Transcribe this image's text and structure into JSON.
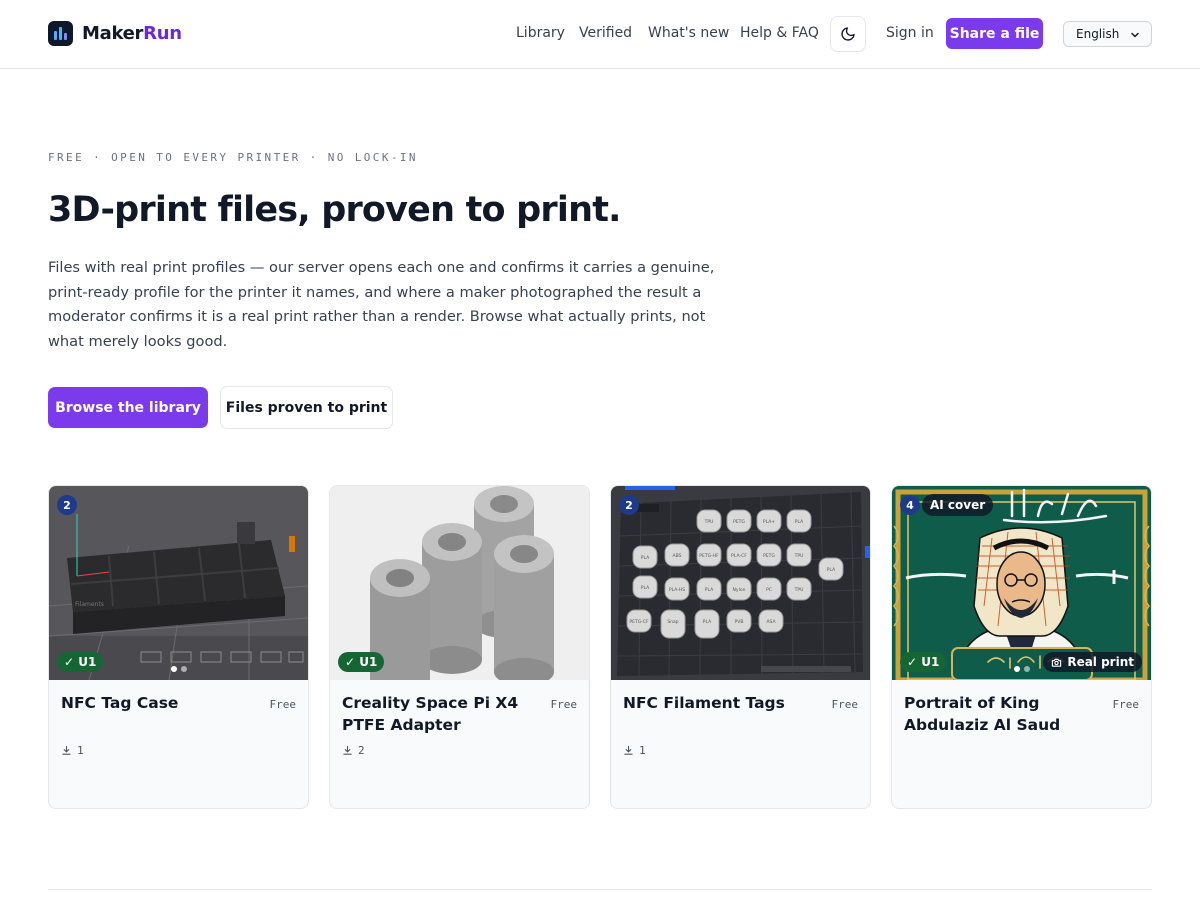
{
  "brand": {
    "name_a": "Maker",
    "name_b": "Run"
  },
  "nav": {
    "library": "Library",
    "verified": "Verified",
    "whats_new": "What's new",
    "help": "Help & FAQ",
    "sign_in": "Sign in",
    "share": "Share a file",
    "language": "English"
  },
  "hero": {
    "eyebrow": "FREE · OPEN TO EVERY PRINTER · NO LOCK-IN",
    "title": "3D-print files, proven to print.",
    "description": "Files with real print profiles — our server opens each one and confirms it carries a genuine, print-ready profile for the printer it names, and where a maker photographed the result a moderator confirms it is a real print rather than a render. Browse what actually prints, not what merely looks good.",
    "primary_cta": "Browse the library",
    "secondary_cta": "Files proven to print"
  },
  "cards": [
    {
      "title": "NFC Tag Case",
      "price": "Free",
      "downloads": "1",
      "image_count": "2",
      "verified": "✓ U1",
      "dots": 2,
      "active_dot": 0
    },
    {
      "title": "Creality Space Pi X4 PTFE Adapter",
      "price": "Free",
      "downloads": "2",
      "verified": "✓ U1"
    },
    {
      "title": "NFC Filament Tags",
      "price": "Free",
      "downloads": "1",
      "image_count": "2"
    },
    {
      "title": "Portrait of King Abdulaziz Al Saud",
      "price": "Free",
      "image_count": "4",
      "ai_badge": "AI cover",
      "verified": "✓ U1",
      "real_print": "Real print",
      "dots": 2,
      "active_dot": 0
    }
  ],
  "colors": {
    "accent": "#7c3aed",
    "verified": "#166534",
    "count_badge": "#1e3a8a"
  }
}
